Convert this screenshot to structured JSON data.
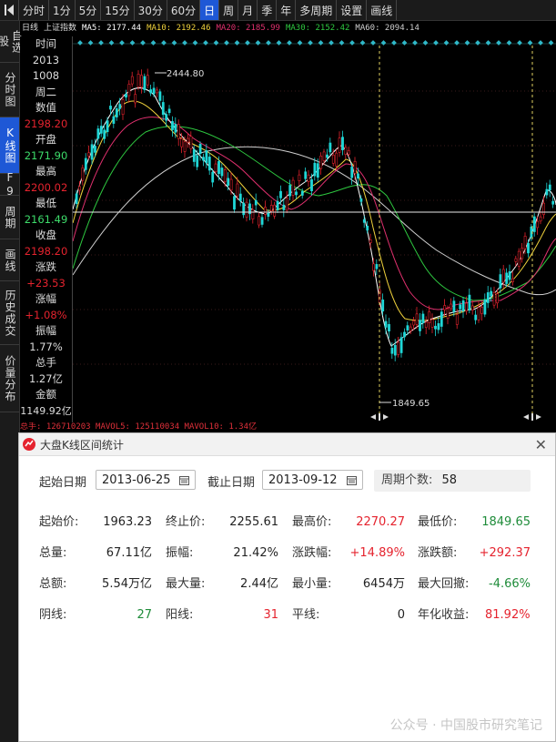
{
  "toolbar": {
    "tabs": [
      "分时",
      "1分",
      "5分",
      "15分",
      "30分",
      "60分",
      "日",
      "周",
      "月",
      "季",
      "年",
      "多周期",
      "设置",
      "画线"
    ],
    "active_index": 6
  },
  "leftnav": {
    "items": [
      "自选股",
      "分时图",
      "K线图",
      "F9",
      "周期",
      "画线",
      "历史成交",
      "价量分布"
    ],
    "active_index": 2
  },
  "ma_line": {
    "period": "日线",
    "index_name": "上证指数",
    "ma5": "MA5: 2177.44",
    "ma10": "MA10: 2192.46",
    "ma20": "MA20: 2185.99",
    "ma30": "MA30: 2152.42",
    "ma60": "MA60: 2094.14"
  },
  "info_panel": {
    "time_label": "时间",
    "year": "2013",
    "date": "1008",
    "weekday": "周二",
    "value_label": "数值",
    "value": "2198.20",
    "open_label": "开盘",
    "open": "2171.90",
    "high_label": "最高",
    "high": "2200.02",
    "low_label": "最低",
    "low": "2161.49",
    "close_label": "收盘",
    "close": "2198.20",
    "change_label": "涨跌",
    "change": "+23.53",
    "pct_label": "涨幅",
    "pct": "+1.08%",
    "amp_label": "振幅",
    "amp": "1.77%",
    "vol_label": "总手",
    "vol": "1.27亿",
    "amount_label": "金额",
    "amount": "1149.92亿"
  },
  "chart_labels": {
    "high_mark": "2444.80",
    "low_mark": "1849.65"
  },
  "vol_strip": "总手: 126710203  MAVOL5: 125110034  MAVOL10: 1.34亿",
  "colors": {
    "up": "#e5232e",
    "down": "#1fd6d6",
    "accent_blue": "#1e58d6",
    "ma5": "#ffffff",
    "ma10": "#f0d23c",
    "ma20": "#e0306e",
    "ma30": "#2ec840",
    "ma60": "#cfcfcf"
  },
  "dialog": {
    "title": "大盘K线区间统计",
    "start_label": "起始日期",
    "start_date": "2013-06-25",
    "end_label": "截止日期",
    "end_date": "2013-09-12",
    "period_label": "周期个数:",
    "period_count": "58",
    "stats": [
      {
        "label": "起始价:",
        "value": "1963.23",
        "color": "black"
      },
      {
        "label": "终止价:",
        "value": "2255.61",
        "color": "black"
      },
      {
        "label": "最高价:",
        "value": "2270.27",
        "color": "red"
      },
      {
        "label": "最低价:",
        "value": "1849.65",
        "color": "green"
      },
      {
        "label": "总量:",
        "value": "67.11亿",
        "color": "black"
      },
      {
        "label": "振幅:",
        "value": "21.42%",
        "color": "black"
      },
      {
        "label": "涨跌幅:",
        "value": "+14.89%",
        "color": "red"
      },
      {
        "label": "涨跌额:",
        "value": "+292.37",
        "color": "red"
      },
      {
        "label": "总额:",
        "value": "5.54万亿",
        "color": "black"
      },
      {
        "label": "最大量:",
        "value": "2.44亿",
        "color": "black"
      },
      {
        "label": "最小量:",
        "value": "6454万",
        "color": "black"
      },
      {
        "label": "最大回撤:",
        "value": "-4.66%",
        "color": "green"
      },
      {
        "label": "阴线:",
        "value": "27",
        "color": "green"
      },
      {
        "label": "阳线:",
        "value": "31",
        "color": "red"
      },
      {
        "label": "平线:",
        "value": "0",
        "color": "black"
      },
      {
        "label": "年化收益:",
        "value": "81.92%",
        "color": "red"
      }
    ]
  },
  "watermark": "公众号 · 中国股市研究笔记"
}
